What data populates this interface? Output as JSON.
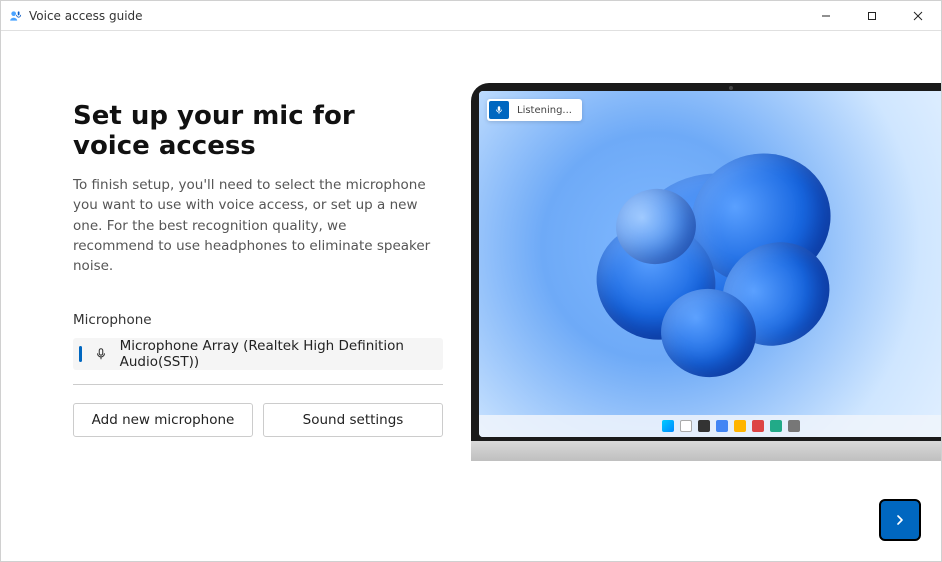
{
  "window": {
    "title": "Voice access guide"
  },
  "main": {
    "heading": "Set up your mic for voice access",
    "description": "To finish setup, you'll need to select the microphone you want to use with voice access, or set up a new one. For the best recognition quality, we recommend to use headphones to eliminate speaker noise.",
    "mic_label": "Microphone",
    "selected_mic": "Microphone Array (Realtek High Definition Audio(SST))",
    "buttons": {
      "add_mic": "Add new microphone",
      "sound_settings": "Sound settings"
    }
  },
  "preview": {
    "voice_access_status": "Listening..."
  },
  "colors": {
    "accent": "#0067c0"
  }
}
